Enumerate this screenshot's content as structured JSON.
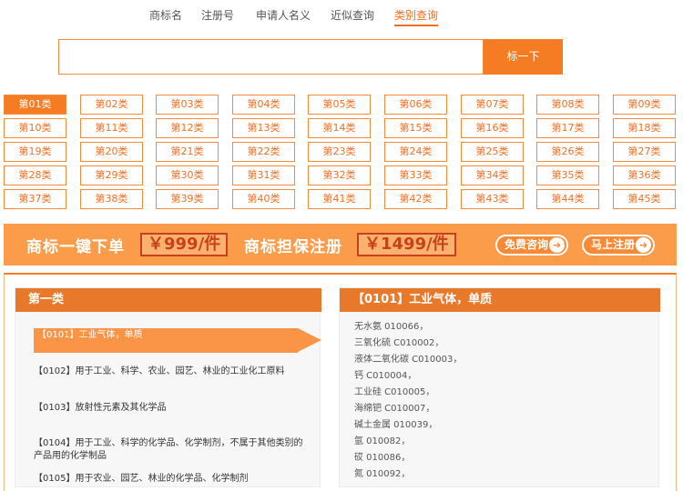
{
  "tabs": [
    {
      "label": "商标名",
      "active": false
    },
    {
      "label": "注册号",
      "active": false
    },
    {
      "label": "申请人名义",
      "active": false
    },
    {
      "label": "近似查询",
      "active": false
    },
    {
      "label": "类别查询",
      "active": true
    }
  ],
  "search": {
    "value": "",
    "button_label": "标一下"
  },
  "classes": [
    "第01类",
    "第02类",
    "第03类",
    "第04类",
    "第05类",
    "第06类",
    "第07类",
    "第08类",
    "第09类",
    "第10类",
    "第11类",
    "第12类",
    "第13类",
    "第14类",
    "第15类",
    "第16类",
    "第17类",
    "第18类",
    "第19类",
    "第20类",
    "第21类",
    "第22类",
    "第23类",
    "第24类",
    "第25类",
    "第26类",
    "第27类",
    "第28类",
    "第29类",
    "第30类",
    "第31类",
    "第32类",
    "第33类",
    "第34类",
    "第35类",
    "第36类",
    "第37类",
    "第38类",
    "第39类",
    "第40类",
    "第41类",
    "第42类",
    "第43类",
    "第44类",
    "第45类"
  ],
  "selected_class": "第01类",
  "banner": {
    "text1": "商标一键下单",
    "price1": "￥999/件",
    "text2": "商标担保注册",
    "price2": "￥1499/件",
    "consult_label": "免费咨询",
    "register_label": "马上注册",
    "accent": "#fb9c4a"
  },
  "left_panel": {
    "title": "第一类",
    "items": [
      {
        "label": "【0101】工业气体，单质",
        "active": true
      },
      {
        "label": "【0102】用于工业、科学、农业、园艺、林业的工业化工原料",
        "active": false
      },
      {
        "label": "【0103】放射性元素及其化学品",
        "active": false
      },
      {
        "label": "【0104】用于工业、科学的化学品、化学制剂，不属于其他类别的产品用的化学制品",
        "active": false
      },
      {
        "label": "【0105】用于农业、园艺、林业的化学品、化学制剂",
        "active": false
      }
    ]
  },
  "right_panel": {
    "title": "【0101】工业气体，单质",
    "goods": [
      "无水氨 010066，",
      "三氧化硫 C010002，",
      "液体二氧化碳 C010003，",
      "钙 C010004，",
      "工业硅 C010005，",
      "海绵钯 C010007，",
      "碱土金属 010039，",
      "氩 010082，",
      "砹 010086，",
      "氮 010092，"
    ]
  },
  "colors": {
    "primary": "#f57c23",
    "panel_header": "#e8782a"
  }
}
